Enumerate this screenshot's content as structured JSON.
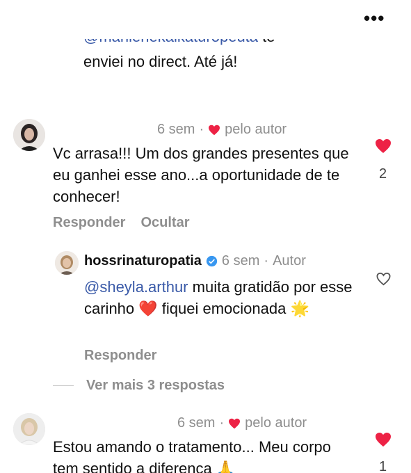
{
  "header": {
    "more_icon": "more-horizontal-icon",
    "more_label": "•••"
  },
  "previous_comment": {
    "mention_cut": "@marilenekaikaturopeuta",
    "mention_cut_rest": " te",
    "text": "enviei no direct. Até já!"
  },
  "comment1": {
    "time": "6 sem",
    "separator": "·",
    "author_badge": "pelo autor",
    "text": "Vc arrasa!!! Um dos grandes presentes que eu ganhei esse ano...a oportunidade de te conhecer!",
    "like_count": "2",
    "actions": {
      "reply": "Responder",
      "hide": "Ocultar"
    }
  },
  "reply1": {
    "username": "hossrinaturopatia",
    "time": "6 sem",
    "separator": "·",
    "role": "Autor",
    "mention": "@sheyla.arthur",
    "text_rest": " muita gratidão por esse carinho ❤️ fiquei emocionada 🌟",
    "actions": {
      "reply": "Responder"
    }
  },
  "view_more": {
    "label": "Ver mais 3 respostas"
  },
  "comment2": {
    "time": "6 sem",
    "separator": "·",
    "author_badge": "pelo autor",
    "text": "Estou amando o tratamento... Meu corpo tem sentido a diferença 🙏",
    "like_count": "1"
  },
  "colors": {
    "like_red": "#ed2245",
    "mention_blue": "#3a5aa8",
    "muted_gray": "#8e8e8e",
    "verified_blue": "#3897f0"
  }
}
